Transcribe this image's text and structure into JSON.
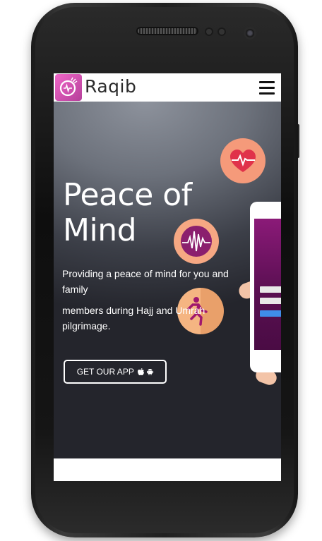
{
  "navbar": {
    "brand": "Raqib",
    "menu_icon": "hamburger-menu-icon"
  },
  "hero": {
    "title_line1": "Peace of",
    "title_line2": "Mind",
    "paragraph_line1": "Providing a peace of mind for you and",
    "paragraph_line2": "family",
    "paragraph_line3": "members during Hajj and Umrah",
    "paragraph_line4": "pilgrimage.",
    "cta_label": "GET OUR APP",
    "cta_icons": [
      "apple-icon",
      "android-icon"
    ]
  },
  "decor_icons": [
    "heart-pulse-icon",
    "waveform-icon",
    "person-running-icon"
  ],
  "colors": {
    "brand_pink": "#d353b4",
    "heart_circle": "#f59a7a",
    "wave_circle": "#f6a883",
    "run_circle": "#f5b582"
  }
}
